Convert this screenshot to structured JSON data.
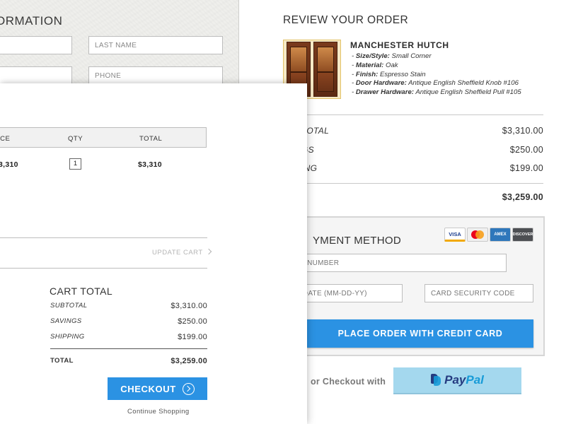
{
  "shipping_info": {
    "title": "ORMATION",
    "last_name_placeholder": "LAST NAME",
    "phone_placeholder": "PHONE"
  },
  "review": {
    "title": "REVIEW YOUR ORDER",
    "product": {
      "name": "MANCHESTER HUTCH",
      "specs": [
        {
          "key": "Size/Style:",
          "value": "Small Corner"
        },
        {
          "key": "Material:",
          "value": "Oak"
        },
        {
          "key": "Finish:",
          "value": "Espresso Stain"
        },
        {
          "key": "Door Hardware:",
          "value": "Antique English Sheffield Knob #106"
        },
        {
          "key": "Drawer Hardware:",
          "value": "Antique English Sheffield Pull #105"
        }
      ]
    },
    "totals": [
      {
        "label": "TOTAL",
        "value": "$3,310.00"
      },
      {
        "label": "GS",
        "value": "$250.00"
      },
      {
        "label": "ING",
        "value": "$199.00"
      }
    ],
    "grand_total": {
      "label": "L",
      "value": "$3,259.00"
    }
  },
  "payment": {
    "title": "YMENT METHOD",
    "cards": [
      "VISA",
      "mastercard",
      "AMEX",
      "DISCOVER"
    ],
    "card_number_placeholder": "ARD NUMBER",
    "exp_date_placeholder": "XP. DATE (MM-DD-YY)",
    "security_code_placeholder": "CARD SECURITY CODE",
    "place_order_label": "PLACE ORDER WITH CREDIT CARD",
    "or_checkout_text": "or Checkout with",
    "paypal_label": "PayPal",
    "colors": {
      "accent": "#2b92e3",
      "paypal_bg": "#a4d8ee"
    }
  },
  "cart": {
    "headers": {
      "price": "ICE",
      "qty": "QTY",
      "total": "TOTAL"
    },
    "row": {
      "price": "3,310",
      "qty": "1",
      "total": "$3,310"
    },
    "update_label": "UPDATE CART",
    "cart_total_title": "CART TOTAL",
    "summary": [
      {
        "label": "SUBTOTAL",
        "value": "$3,310.00"
      },
      {
        "label": "SAVINGS",
        "value": "$250.00"
      },
      {
        "label": "SHIPPING",
        "value": "$199.00"
      }
    ],
    "total": {
      "label": "TOTAL",
      "value": "$3,259.00"
    },
    "checkout_label": "CHECKOUT",
    "continue_label": "Continue Shopping"
  }
}
